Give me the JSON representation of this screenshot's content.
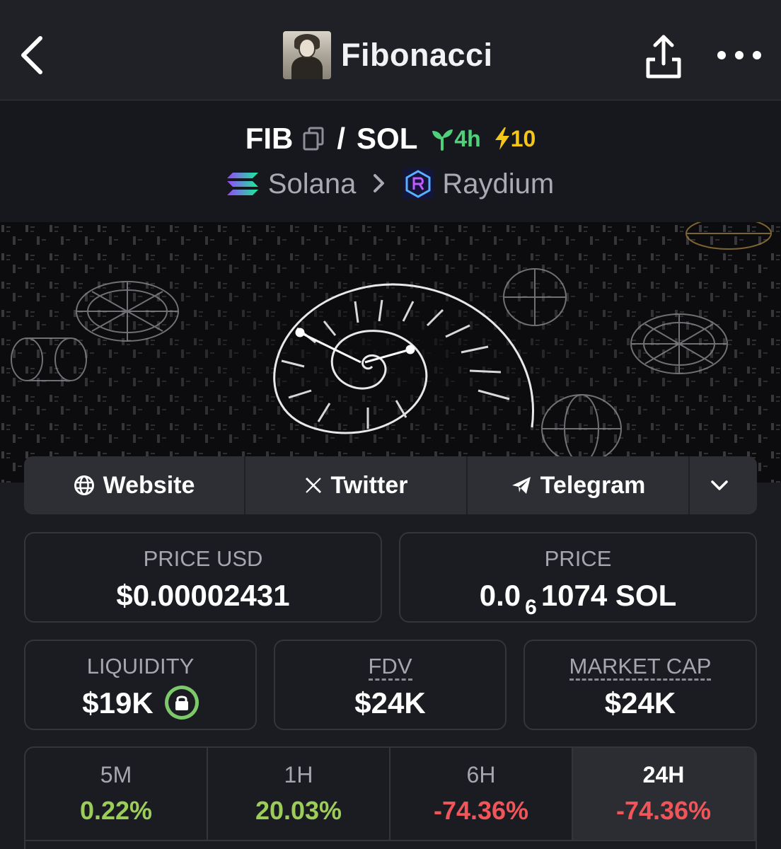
{
  "header": {
    "title": "Fibonacci"
  },
  "pair": {
    "base": "FIB",
    "separator": "/",
    "quote": "SOL",
    "age": "4h",
    "boosts": "10",
    "chain": "Solana",
    "dex": "Raydium"
  },
  "links": {
    "website": "Website",
    "twitter": "Twitter",
    "telegram": "Telegram"
  },
  "stats": {
    "price_usd_label": "PRICE USD",
    "price_usd_value": "$0.00002431",
    "price_label": "PRICE",
    "price_prefix": "0.0",
    "price_zeros": "6",
    "price_suffix": "1074 SOL",
    "liquidity_label": "LIQUIDITY",
    "liquidity_value": "$19K",
    "fdv_label": "FDV",
    "fdv_value": "$24K",
    "mcap_label": "MARKET CAP",
    "mcap_value": "$24K"
  },
  "timeframes": [
    {
      "label": "5M",
      "value": "0.22%",
      "color": "#9ccc5a"
    },
    {
      "label": "1H",
      "value": "20.03%",
      "color": "#9ccc5a"
    },
    {
      "label": "6H",
      "value": "-74.36%",
      "color": "#f0555a"
    },
    {
      "label": "24H",
      "value": "-74.36%",
      "color": "#f0555a"
    }
  ],
  "colors": {
    "positive": "#9ccc5a",
    "negative": "#f0555a",
    "age_green": "#4fd07a",
    "boost_yellow": "#f5c518"
  },
  "icons": [
    "back-arrow-icon",
    "share-icon",
    "more-dots-icon",
    "copy-icon",
    "seedling-icon",
    "lightning-icon",
    "solana-icon",
    "raydium-icon",
    "globe-icon",
    "x-icon",
    "telegram-icon",
    "chevron-down-icon",
    "lock-icon"
  ]
}
